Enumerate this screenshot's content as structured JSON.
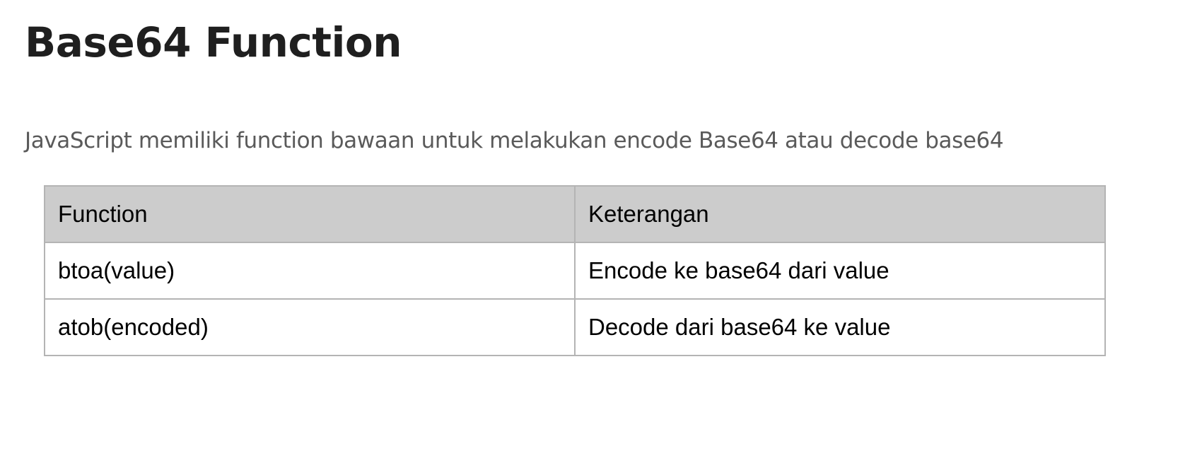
{
  "page": {
    "title": "Base64 Function",
    "intro": "JavaScript memiliki function bawaan untuk melakukan encode Base64 atau decode base64"
  },
  "table": {
    "headers": [
      "Function",
      "Keterangan"
    ],
    "rows": [
      [
        "btoa(value)",
        "Encode ke base64 dari value"
      ],
      [
        "atob(encoded)",
        "Decode dari base64 ke value"
      ]
    ],
    "colors": {
      "header_background": "#cccccc",
      "border": "#b4b4b4"
    }
  }
}
